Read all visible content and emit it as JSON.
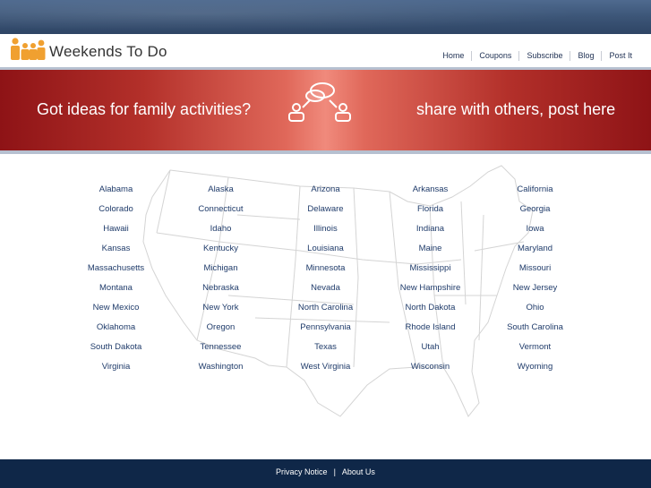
{
  "header": {
    "brand": "Weekends To Do",
    "nav": [
      "Home",
      "Coupons",
      "Subscribe",
      "Blog",
      "Post It"
    ]
  },
  "banner": {
    "left_text": "Got ideas for family activities?",
    "right_text": "share with others, post here",
    "icon": "chat-people-icon"
  },
  "states": [
    "Alabama",
    "Alaska",
    "Arizona",
    "Arkansas",
    "California",
    "Colorado",
    "Connecticut",
    "Delaware",
    "Florida",
    "Georgia",
    "Hawaii",
    "Idaho",
    "Illinois",
    "Indiana",
    "Iowa",
    "Kansas",
    "Kentucky",
    "Louisiana",
    "Maine",
    "Maryland",
    "Massachusetts",
    "Michigan",
    "Minnesota",
    "Mississippi",
    "Missouri",
    "Montana",
    "Nebraska",
    "Nevada",
    "New Hampshire",
    "New Jersey",
    "New Mexico",
    "New York",
    "North Carolina",
    "North Dakota",
    "Ohio",
    "Oklahoma",
    "Oregon",
    "Pennsylvania",
    "Rhode Island",
    "South Carolina",
    "South Dakota",
    "Tennessee",
    "Texas",
    "Utah",
    "Vermont",
    "Virginia",
    "Washington",
    "West Virginia",
    "Wisconsin",
    "Wyoming"
  ],
  "footer": {
    "privacy": "Privacy Notice",
    "separator": "|",
    "about": "About Us"
  },
  "colors": {
    "banner_red": "#b3302a",
    "footer_navy": "#0f2748",
    "logo_orange": "#f0a030",
    "state_link": "#1f3b6a"
  }
}
